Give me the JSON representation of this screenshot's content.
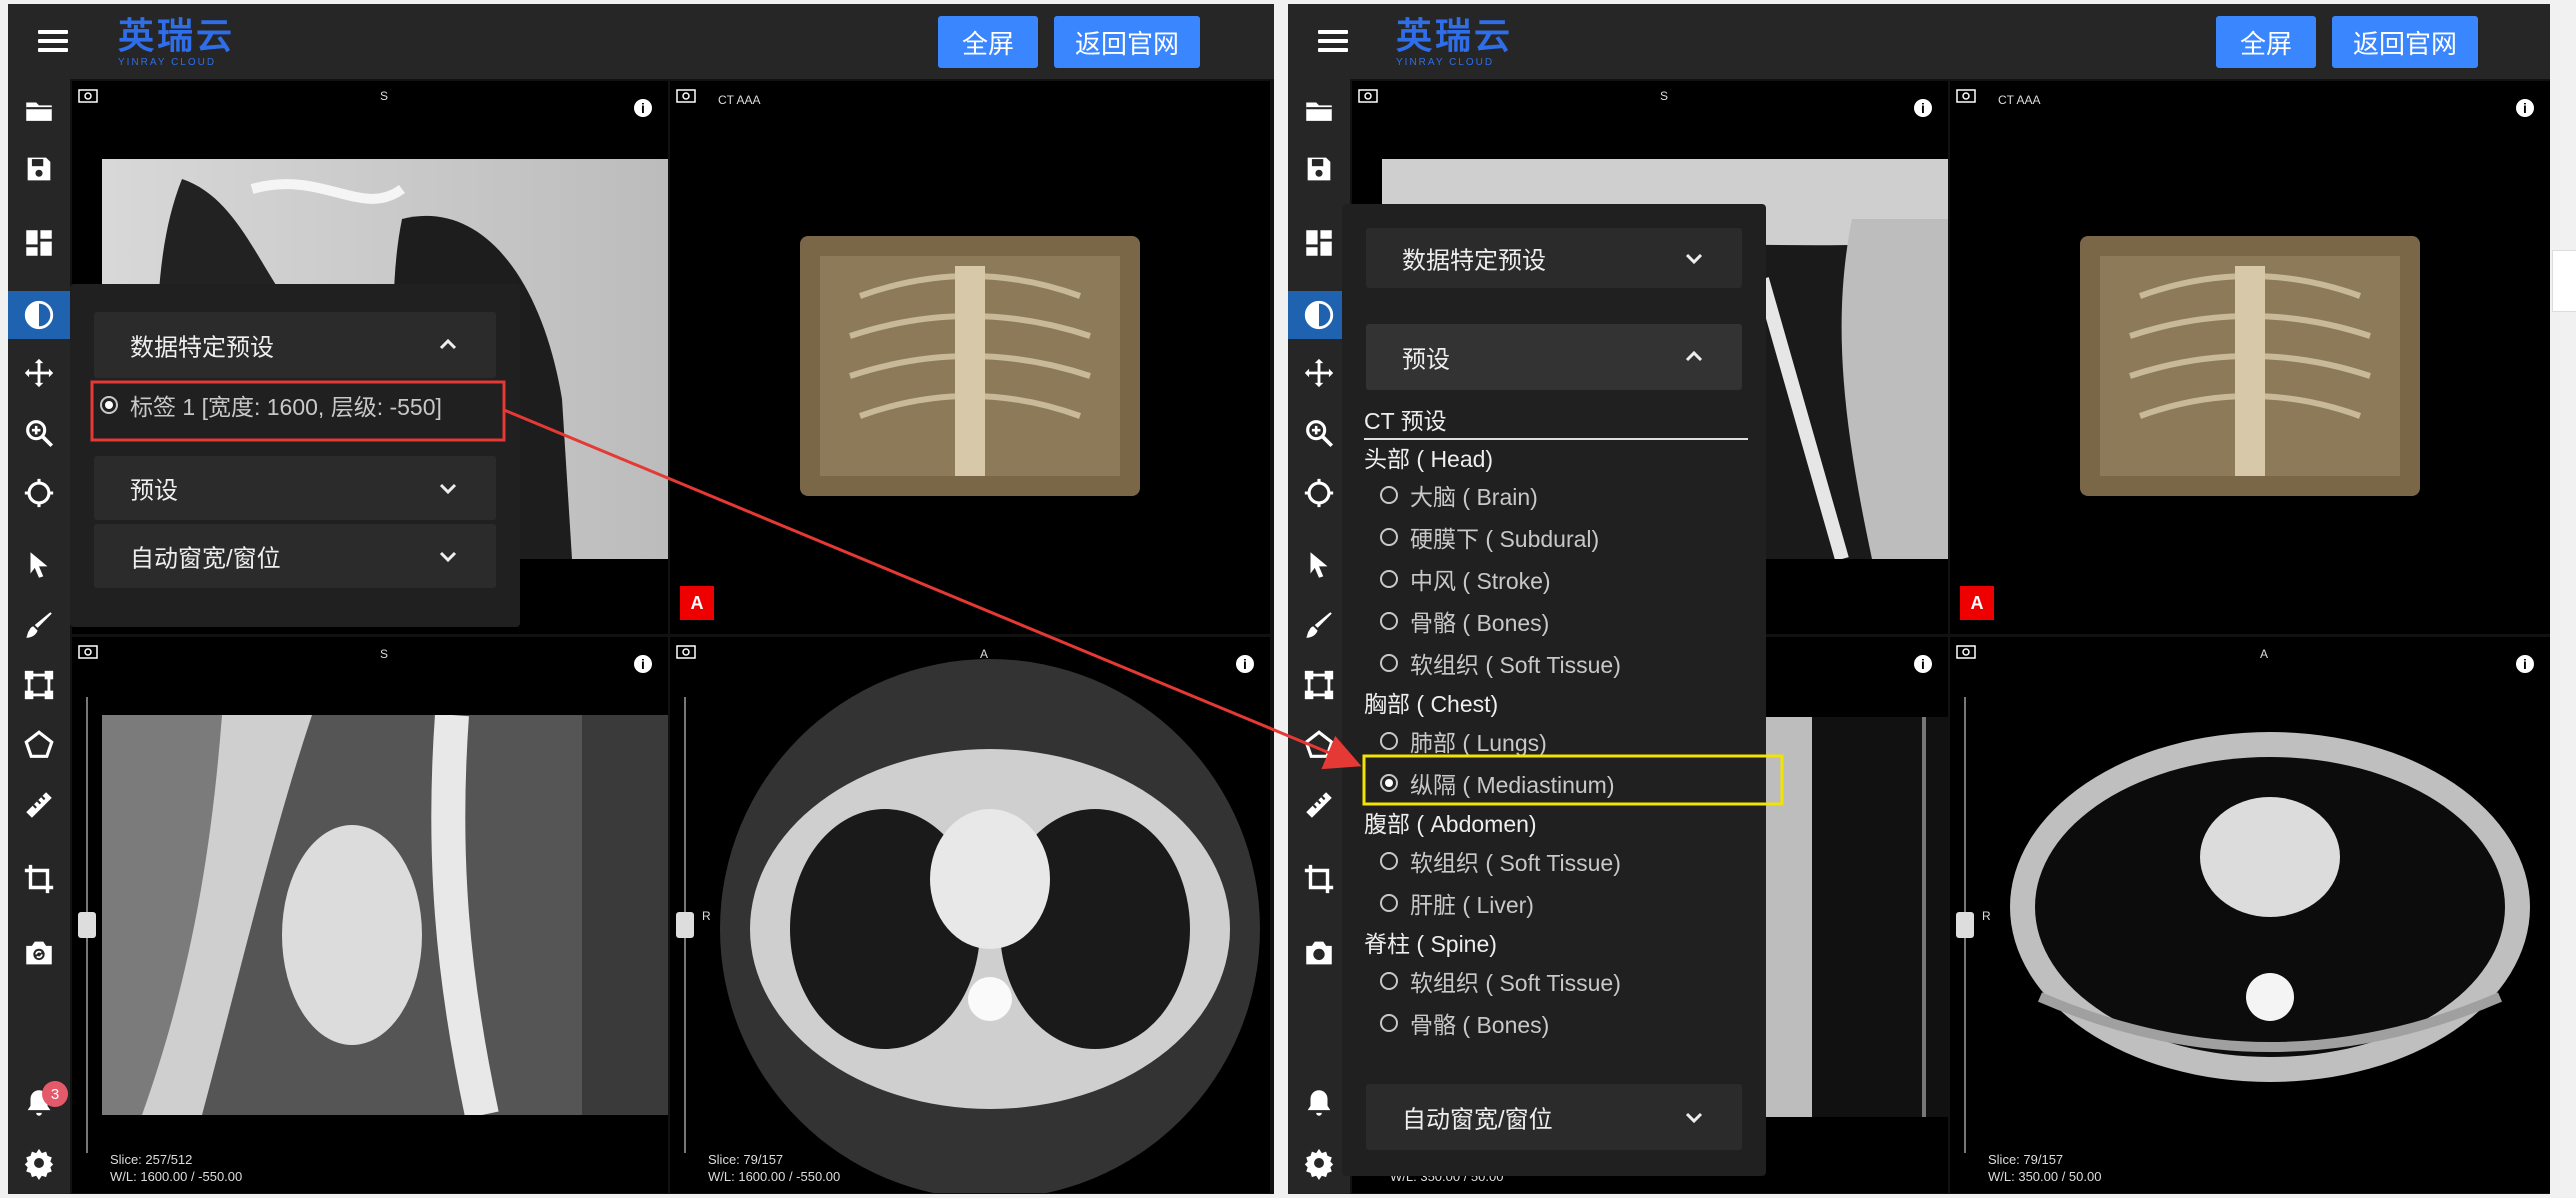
{
  "app": {
    "logo_cn": "英瑞云",
    "logo_en": "YINRAY CLOUD",
    "fullscreen_label": "全屏",
    "back_label": "返回官网"
  },
  "left": {
    "notifications_count": "3",
    "viewports": {
      "sag_top_orient": "S",
      "vr_label": "CT AAA",
      "vr_marker": "A",
      "sag2_orient": "S",
      "sag2_side": "A",
      "sag2_slice": "Slice: 257/512",
      "sag2_wl": "W/L: 1600.00 / -550.00",
      "ax_orient": "A",
      "ax_side": "R",
      "ax_slice": "Slice: 79/157",
      "ax_wl": "W/L: 1600.00 / -550.00"
    },
    "panel": {
      "data_presets": "数据特定预设",
      "tag_option": "标签 1 [宽度: 1600, 层级: -550]",
      "presets": "预设",
      "auto_window": "自动窗宽/窗位"
    }
  },
  "right": {
    "viewports": {
      "sag_top_orient": "S",
      "vr_label": "CT AAA",
      "vr_marker": "A",
      "ax_orient": "A",
      "ax_side": "R",
      "ax_slice": "Slice: 79/157",
      "ax_wl": "W/L: 350.00 / 50.00",
      "bl_wl": "W/L: 350.00 / 50.00"
    },
    "panel": {
      "data_presets": "数据特定预设",
      "presets": "预设",
      "ct_presets": "CT 预设",
      "groups": [
        {
          "name": "头部 ( Head)",
          "items": [
            "大脑 ( Brain)",
            "硬膜下 ( Subdural)",
            "中风 ( Stroke)",
            "骨骼 ( Bones)",
            "软组织 ( Soft Tissue)"
          ]
        },
        {
          "name": "胸部 ( Chest)",
          "items": [
            "肺部 ( Lungs)",
            "纵隔 ( Mediastinum)"
          ]
        },
        {
          "name": "腹部 ( Abdomen)",
          "items": [
            "软组织 ( Soft Tissue)",
            "肝脏 ( Liver)"
          ]
        },
        {
          "name": "脊柱 ( Spine)",
          "items": [
            "软组织 ( Soft Tissue)",
            "骨骼 ( Bones)"
          ]
        }
      ],
      "selected": "纵隔 ( Mediastinum)",
      "auto_window": "自动窗宽/窗位"
    }
  },
  "colors": {
    "brand_blue": "#2f6ee8",
    "button_blue": "#3a86ff",
    "annotation_red": "#e53935",
    "highlight_yellow": "#f2e400"
  }
}
